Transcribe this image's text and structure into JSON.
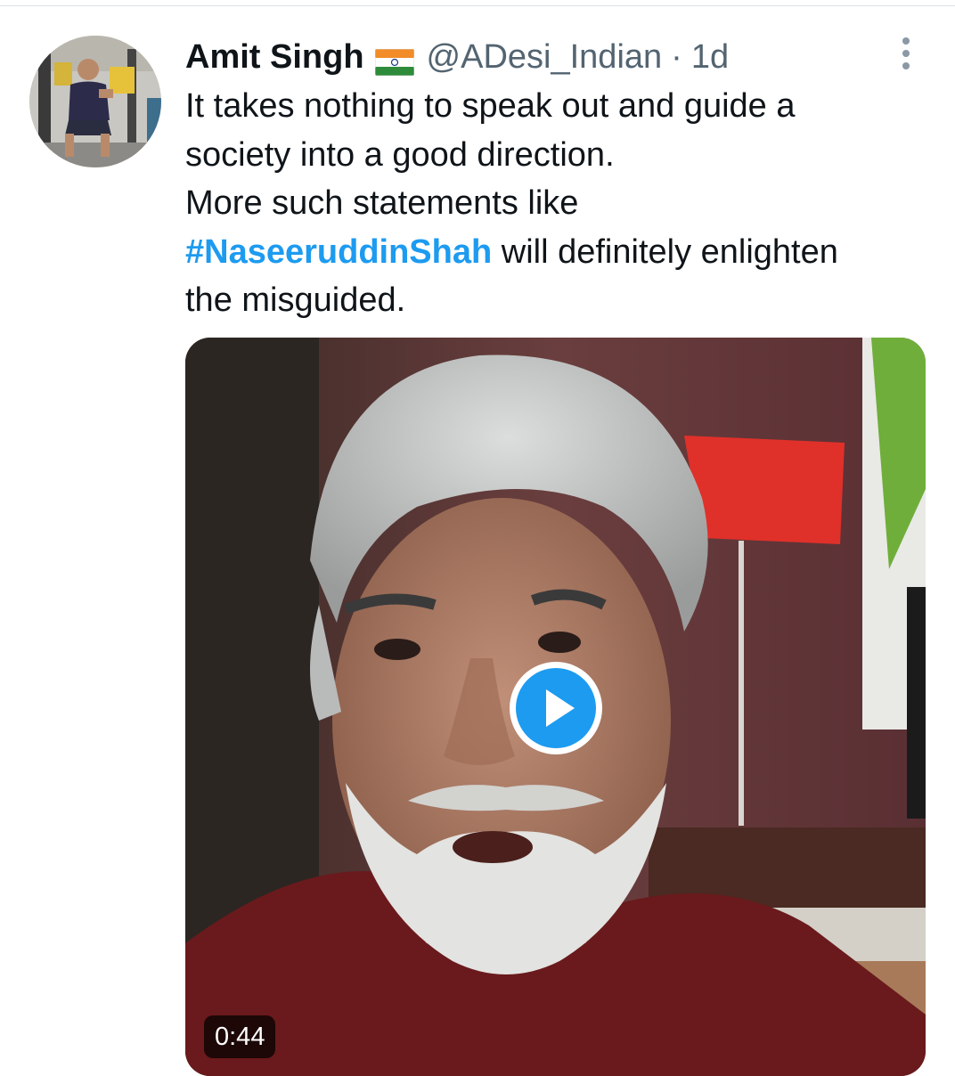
{
  "tweet": {
    "author": {
      "display_name": "Amit Singh",
      "handle": "@ADesi_Indian",
      "flag_icon": "india-flag-icon"
    },
    "separator": "·",
    "time": "1d",
    "text_lines": [
      "It takes nothing to speak out and guide a",
      "society into a good direction.",
      "More such statements like"
    ],
    "hashtag": "#NaseeruddinShah",
    "hashtag_line_rest": " will definitely enlighten",
    "last_line": "the misguided.",
    "media": {
      "type": "video",
      "duration": "0:44",
      "play_icon": "play-icon"
    }
  },
  "colors": {
    "link_blue": "#1d9bf0",
    "secondary_text": "#536471",
    "primary_text": "#0f1419"
  }
}
